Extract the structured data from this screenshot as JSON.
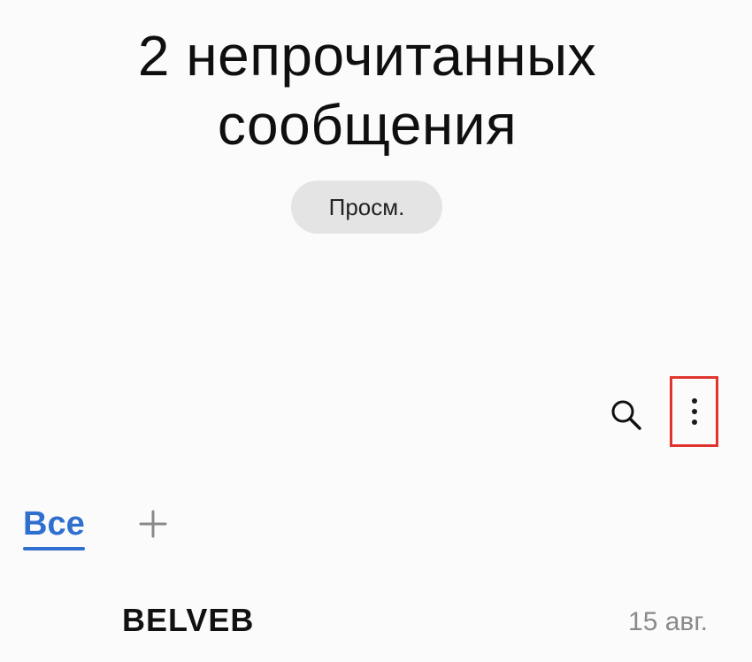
{
  "header": {
    "title_line1": "2 непрочитанных",
    "title_line2": "сообщения",
    "view_button_label": "Просм."
  },
  "toolbar": {
    "search_icon": "search-icon",
    "more_icon": "more-vertical-icon",
    "highlight_color": "#e0352f"
  },
  "tabs": {
    "all_label": "Все",
    "add_icon": "plus-icon",
    "active_color": "#2f6fcf"
  },
  "conversations": [
    {
      "sender": "BELVEB",
      "date": "15 авг."
    }
  ]
}
